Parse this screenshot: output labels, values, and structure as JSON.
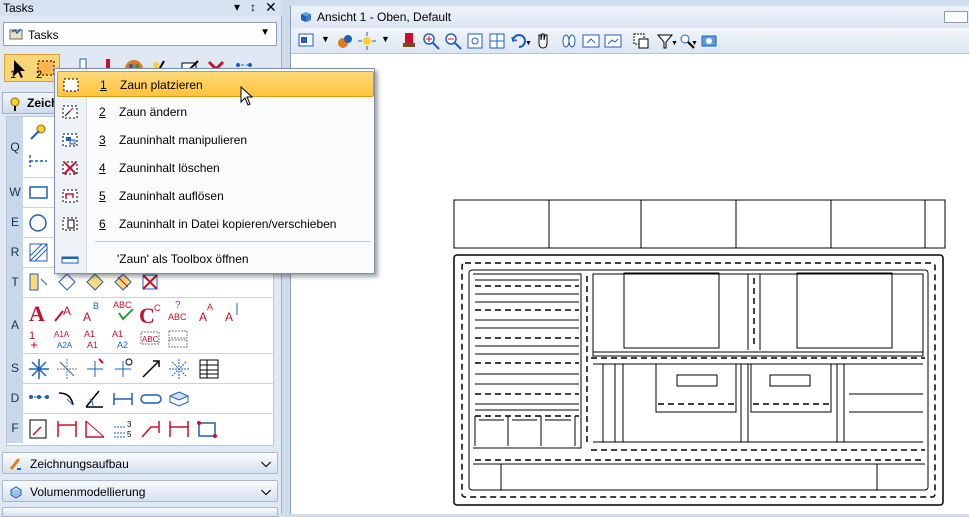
{
  "task_panel": {
    "title": "Tasks",
    "pin_glyph": "▾",
    "pin2_glyph": "↕",
    "close_glyph": "✕",
    "dropdown": {
      "icon": "tasks-icon",
      "label": "Tasks",
      "arrow": "▼"
    },
    "strip_numbers": [
      "1",
      "2"
    ],
    "section_title": "Zeichnen",
    "row_letters": [
      "Q",
      "W",
      "E",
      "R",
      "T",
      "A",
      "S",
      "D",
      "F"
    ],
    "sections": [
      {
        "label": "Zeichnungsaufbau",
        "icon": "drawing-setup-icon",
        "chevron": "⌄"
      },
      {
        "label": "Volumenmodellierung",
        "icon": "solid-modeling-icon",
        "chevron": "⌄"
      }
    ]
  },
  "view": {
    "title": "Ansicht 1 - Oben, Default",
    "toolbar_icons": [
      "view-attributes-icon",
      "display-style-icon",
      "lights-icon",
      "update-view-icon",
      "zoom-in-icon",
      "zoom-out-icon",
      "window-area-icon",
      "fit-view-icon",
      "rotate-view-icon",
      "pan-view-icon",
      "walk-icon",
      "view-previous-icon",
      "view-next-icon",
      "clip-volume-icon",
      "clip-mask-icon",
      "level-display-icon",
      "camera-icon"
    ]
  },
  "fence_menu": {
    "items": [
      {
        "num": "1",
        "label": "Zaun platzieren",
        "icon": "place-fence-icon",
        "active": true
      },
      {
        "num": "2",
        "label": "Zaun ändern",
        "icon": "modify-fence-icon"
      },
      {
        "num": "3",
        "label": "Zauninhalt manipulieren",
        "icon": "manipulate-fence-icon"
      },
      {
        "num": "4",
        "label": "Zauninhalt löschen",
        "icon": "delete-fence-icon"
      },
      {
        "num": "5",
        "label": "Zauninhalt auflösen",
        "icon": "drop-fence-icon"
      },
      {
        "num": "6",
        "label": "Zauninhalt in Datei kopieren/verschieben",
        "icon": "fence-file-icon"
      }
    ],
    "toolbox_label": "'Zaun' als Toolbox öffnen",
    "toolbox_icon": "toolbox-icon"
  },
  "colors": {
    "menu_highlight": "#ffc33d",
    "panel_bg": "#dfe8f3",
    "row_letter_bg": "#c9d7ea",
    "icon_blue": "#1f5fb8",
    "icon_red": "#c8102e"
  }
}
